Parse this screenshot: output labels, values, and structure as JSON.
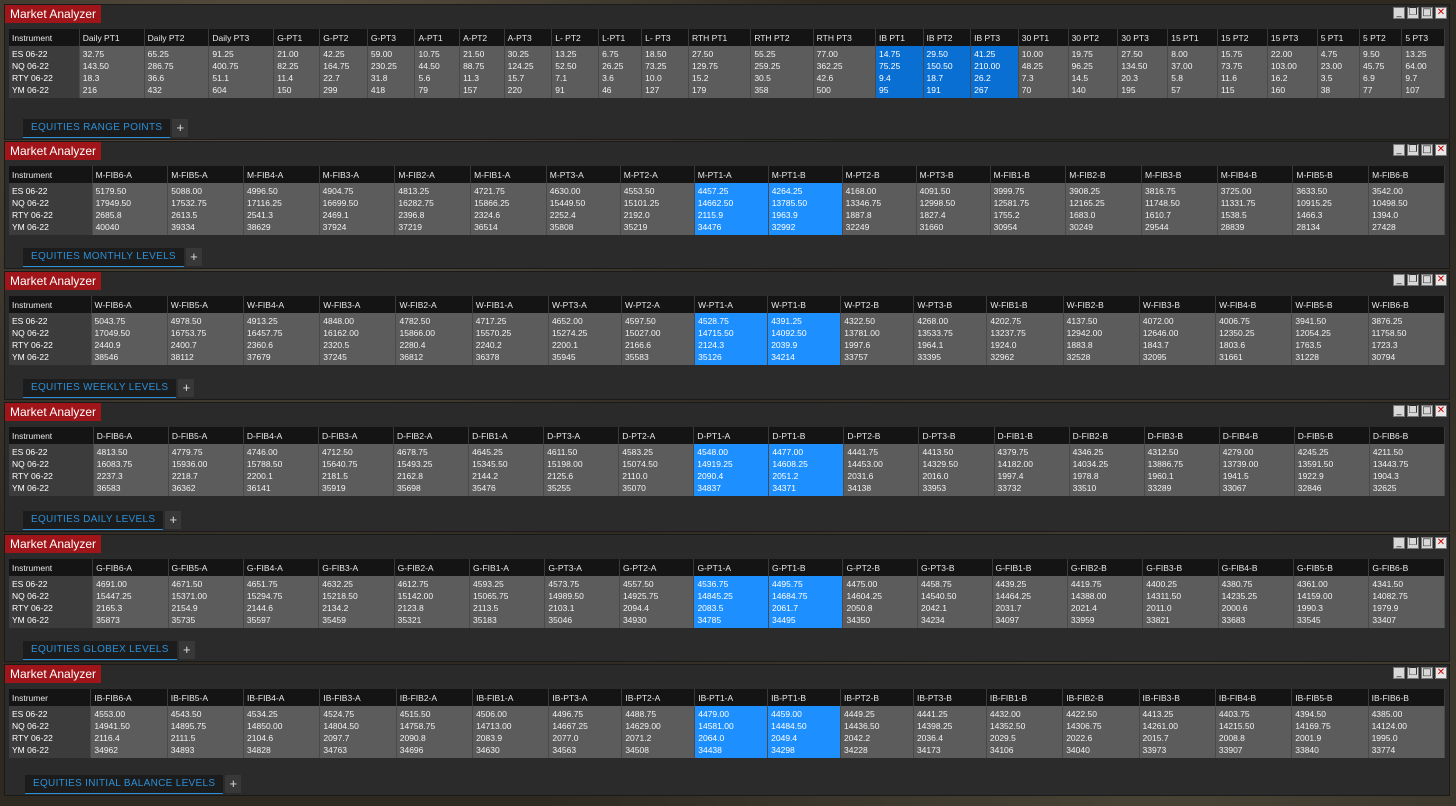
{
  "app_title": "Market Analyzer",
  "window_buttons": [
    "minimize-icon",
    "restore-icon",
    "maximize-icon",
    "close-icon"
  ],
  "colors": {
    "title_bg": "#a0151a",
    "highlight": "#1e8fff",
    "highlight_dark": "#0a6fd2",
    "tab_text": "#2d8fd6"
  },
  "windows": [
    {
      "tab": "EQUITIES RANGE POINTS",
      "headers": [
        "Instrument",
        "Daily PT1",
        "Daily PT2",
        "Daily PT3",
        "G-PT1",
        "G-PT2",
        "G-PT3",
        "A-PT1",
        "A-PT2",
        "A-PT3",
        "L- PT2",
        "L-PT1",
        "L- PT3",
        "RTH PT1",
        "RTH PT2",
        "RTH PT3",
        "IB PT1",
        "IB PT2",
        "IB PT3",
        "30 PT1",
        "30 PT2",
        "30 PT3",
        "15 PT1",
        "15 PT2",
        "15 PT3",
        "5 PT1",
        "5 PT2",
        "5 PT3"
      ],
      "highlight_cols": [
        16,
        17,
        18
      ],
      "dark_highlight": true,
      "rows": [
        [
          "ES 06-22",
          "32.75",
          "65.25",
          "91.25",
          "21.00",
          "42.25",
          "59.00",
          "10.75",
          "21.50",
          "30.25",
          "13.25",
          "6.75",
          "18.50",
          "27.50",
          "55.25",
          "77.00",
          "14.75",
          "29.50",
          "41.25",
          "10.00",
          "19.75",
          "27.50",
          "8.00",
          "15.75",
          "22.00",
          "4.75",
          "9.50",
          "13.25"
        ],
        [
          "NQ 06-22",
          "143.50",
          "286.75",
          "400.75",
          "82.25",
          "164.75",
          "230.25",
          "44.50",
          "88.75",
          "124.25",
          "52.50",
          "26.25",
          "73.25",
          "129.75",
          "259.25",
          "362.25",
          "75.25",
          "150.50",
          "210.00",
          "48.25",
          "96.25",
          "134.50",
          "37.00",
          "73.75",
          "103.00",
          "23.00",
          "45.75",
          "64.00"
        ],
        [
          "RTY 06-22",
          "18.3",
          "36.6",
          "51.1",
          "11.4",
          "22.7",
          "31.8",
          "5.6",
          "11.3",
          "15.7",
          "7.1",
          "3.6",
          "10.0",
          "15.2",
          "30.5",
          "42.6",
          "9.4",
          "18.7",
          "26.2",
          "7.3",
          "14.5",
          "20.3",
          "5.8",
          "11.6",
          "16.2",
          "3.5",
          "6.9",
          "9.7"
        ],
        [
          "YM 06-22",
          "216",
          "432",
          "604",
          "150",
          "299",
          "418",
          "79",
          "157",
          "220",
          "91",
          "46",
          "127",
          "179",
          "358",
          "500",
          "95",
          "191",
          "267",
          "70",
          "140",
          "195",
          "57",
          "115",
          "160",
          "38",
          "77",
          "107"
        ]
      ]
    },
    {
      "tab": "EQUITIES MONTHLY LEVELS",
      "headers": [
        "Instrument",
        "M-FIB6-A",
        "M-FIB5-A",
        "M-FIB4-A",
        "M-FIB3-A",
        "M-FIB2-A",
        "M-FIB1-A",
        "M-PT3-A",
        "M-PT2-A",
        "M-PT1-A",
        "M-PT1-B",
        "M-PT2-B",
        "M-PT3-B",
        "M-FIB1-B",
        "M-FIB2-B",
        "M-FIB3-B",
        "M-FIB4-B",
        "M-FIB5-B",
        "M-FIB6-B"
      ],
      "highlight_cols": [
        9,
        10
      ],
      "dark_highlight": false,
      "rows": [
        [
          "ES 06-22",
          "5179.50",
          "5088.00",
          "4996.50",
          "4904.75",
          "4813.25",
          "4721.75",
          "4630.00",
          "4553.50",
          "4457.25",
          "4264.25",
          "4168.00",
          "4091.50",
          "3999.75",
          "3908.25",
          "3816.75",
          "3725.00",
          "3633.50",
          "3542.00"
        ],
        [
          "NQ 06-22",
          "17949.50",
          "17532.75",
          "17116.25",
          "16699.50",
          "16282.75",
          "15866.25",
          "15449.50",
          "15101.25",
          "14662.50",
          "13785.50",
          "13346.75",
          "12998.50",
          "12581.75",
          "12165.25",
          "11748.50",
          "11331.75",
          "10915.25",
          "10498.50"
        ],
        [
          "RTY 06-22",
          "2685.8",
          "2613.5",
          "2541.3",
          "2469.1",
          "2396.8",
          "2324.6",
          "2252.4",
          "2192.0",
          "2115.9",
          "1963.9",
          "1887.8",
          "1827.4",
          "1755.2",
          "1683.0",
          "1610.7",
          "1538.5",
          "1466.3",
          "1394.0"
        ],
        [
          "YM 06-22",
          "40040",
          "39334",
          "38629",
          "37924",
          "37219",
          "36514",
          "35808",
          "35219",
          "34476",
          "32992",
          "32249",
          "31660",
          "30954",
          "30249",
          "29544",
          "28839",
          "28134",
          "27428"
        ]
      ]
    },
    {
      "tab": "EQUITIES WEEKLY LEVELS",
      "headers": [
        "Instrument",
        "W-FIB6-A",
        "W-FIB5-A",
        "W-FIB4-A",
        "W-FIB3-A",
        "W-FIB2-A",
        "W-FIB1-A",
        "W-PT3-A",
        "W-PT2-A",
        "W-PT1-A",
        "W-PT1-B",
        "W-PT2-B",
        "W-PT3-B",
        "W-FIB1-B",
        "W-FIB2-B",
        "W-FIB3-B",
        "W-FIB4-B",
        "W-FIB5-B",
        "W-FIB6-B"
      ],
      "highlight_cols": [
        9,
        10
      ],
      "dark_highlight": false,
      "rows": [
        [
          "ES 06-22",
          "5043.75",
          "4978.50",
          "4913.25",
          "4848.00",
          "4782.50",
          "4717.25",
          "4652.00",
          "4597.50",
          "4528.75",
          "4391.25",
          "4322.50",
          "4268.00",
          "4202.75",
          "4137.50",
          "4072.00",
          "4006.75",
          "3941.50",
          "3876.25"
        ],
        [
          "NQ 06-22",
          "17049.50",
          "16753.75",
          "16457.75",
          "16162.00",
          "15866.00",
          "15570.25",
          "15274.25",
          "15027.00",
          "14715.50",
          "14092.50",
          "13781.00",
          "13533.75",
          "13237.75",
          "12942.00",
          "12646.00",
          "12350.25",
          "12054.25",
          "11758.50"
        ],
        [
          "RTY 06-22",
          "2440.9",
          "2400.7",
          "2360.6",
          "2320.5",
          "2280.4",
          "2240.2",
          "2200.1",
          "2166.6",
          "2124.3",
          "2039.9",
          "1997.6",
          "1964.1",
          "1924.0",
          "1883.8",
          "1843.7",
          "1803.6",
          "1763.5",
          "1723.3"
        ],
        [
          "YM 06-22",
          "38546",
          "38112",
          "37679",
          "37245",
          "36812",
          "36378",
          "35945",
          "35583",
          "35126",
          "34214",
          "33757",
          "33395",
          "32962",
          "32528",
          "32095",
          "31661",
          "31228",
          "30794"
        ]
      ]
    },
    {
      "tab": "EQUITIES DAILY LEVELS",
      "headers": [
        "Instrument",
        "D-FIB6-A",
        "D-FIB5-A",
        "D-FIB4-A",
        "D-FIB3-A",
        "D-FIB2-A",
        "D-FIB1-A",
        "D-PT3-A",
        "D-PT2-A",
        "D-PT1-A",
        "D-PT1-B",
        "D-PT2-B",
        "D-PT3-B",
        "D-FIB1-B",
        "D-FIB2-B",
        "D-FIB3-B",
        "D-FIB4-B",
        "D-FIB5-B",
        "D-FIB6-B"
      ],
      "highlight_cols": [
        9,
        10
      ],
      "dark_highlight": false,
      "rows": [
        [
          "ES 06-22",
          "4813.50",
          "4779.75",
          "4746.00",
          "4712.50",
          "4678.75",
          "4645.25",
          "4611.50",
          "4583.25",
          "4548.00",
          "4477.00",
          "4441.75",
          "4413.50",
          "4379.75",
          "4346.25",
          "4312.50",
          "4279.00",
          "4245.25",
          "4211.50"
        ],
        [
          "NQ 06-22",
          "16083.75",
          "15936.00",
          "15788.50",
          "15640.75",
          "15493.25",
          "15345.50",
          "15198.00",
          "15074.50",
          "14919.25",
          "14608.25",
          "14453.00",
          "14329.50",
          "14182.00",
          "14034.25",
          "13886.75",
          "13739.00",
          "13591.50",
          "13443.75"
        ],
        [
          "RTY 06-22",
          "2237.3",
          "2218.7",
          "2200.1",
          "2181.5",
          "2162.8",
          "2144.2",
          "2125.6",
          "2110.0",
          "2090.4",
          "2051.2",
          "2031.6",
          "2016.0",
          "1997.4",
          "1978.8",
          "1960.1",
          "1941.5",
          "1922.9",
          "1904.3"
        ],
        [
          "YM 06-22",
          "36583",
          "36362",
          "36141",
          "35919",
          "35698",
          "35476",
          "35255",
          "35070",
          "34837",
          "34371",
          "34138",
          "33953",
          "33732",
          "33510",
          "33289",
          "33067",
          "32846",
          "32625"
        ]
      ]
    },
    {
      "tab": "EQUITIES GLOBEX LEVELS",
      "headers": [
        "Instrument",
        "G-FIB6-A",
        "G-FIB5-A",
        "G-FIB4-A",
        "G-FIB3-A",
        "G-FIB2-A",
        "G-FIB1-A",
        "G-PT3-A",
        "G-PT2-A",
        "G-PT1-A",
        "G-PT1-B",
        "G-PT2-B",
        "G-PT3-B",
        "G-FIB1-B",
        "G-FIB2-B",
        "G-FIB3-B",
        "G-FIB4-B",
        "G-FIB5-B",
        "G-FIB6-B"
      ],
      "highlight_cols": [
        9,
        10
      ],
      "dark_highlight": false,
      "rows": [
        [
          "ES 06-22",
          "4691.00",
          "4671.50",
          "4651.75",
          "4632.25",
          "4612.75",
          "4593.25",
          "4573.75",
          "4557.50",
          "4536.75",
          "4495.75",
          "4475.00",
          "4458.75",
          "4439.25",
          "4419.75",
          "4400.25",
          "4380.75",
          "4361.00",
          "4341.50"
        ],
        [
          "NQ 06-22",
          "15447.25",
          "15371.00",
          "15294.75",
          "15218.50",
          "15142.00",
          "15065.75",
          "14989.50",
          "14925.75",
          "14845.25",
          "14684.75",
          "14604.25",
          "14540.50",
          "14464.25",
          "14388.00",
          "14311.50",
          "14235.25",
          "14159.00",
          "14082.75"
        ],
        [
          "RTY 06-22",
          "2165.3",
          "2154.9",
          "2144.6",
          "2134.2",
          "2123.8",
          "2113.5",
          "2103.1",
          "2094.4",
          "2083.5",
          "2061.7",
          "2050.8",
          "2042.1",
          "2031.7",
          "2021.4",
          "2011.0",
          "2000.6",
          "1990.3",
          "1979.9"
        ],
        [
          "YM 06-22",
          "35873",
          "35735",
          "35597",
          "35459",
          "35321",
          "35183",
          "35046",
          "34930",
          "34785",
          "34495",
          "34350",
          "34234",
          "34097",
          "33959",
          "33821",
          "33683",
          "33545",
          "33407"
        ]
      ]
    },
    {
      "tab": "EQUITIES INITIAL BALANCE LEVELS",
      "headers": [
        "Instrumer",
        "IB-FIB6-A",
        "IB-FIB5-A",
        "IB-FIB4-A",
        "IB-FIB3-A",
        "IB-FIB2-A",
        "IB-FIB1-A",
        "IB-PT3-A",
        "IB-PT2-A",
        "IB-PT1-A",
        "IB-PT1-B",
        "IB-PT2-B",
        "IB-PT3-B",
        "IB-FIB1-B",
        "IB-FIB2-B",
        "IB-FIB3-B",
        "IB-FIB4-B",
        "IB-FIB5-B",
        "IB-FIB6-B"
      ],
      "highlight_cols": [
        9,
        10
      ],
      "dark_highlight": false,
      "rows": [
        [
          "ES 06-22",
          "4553.00",
          "4543.50",
          "4534.25",
          "4524.75",
          "4515.50",
          "4506.00",
          "4496.75",
          "4488.75",
          "4479.00",
          "4459.00",
          "4449.25",
          "4441.25",
          "4432.00",
          "4422.50",
          "4413.25",
          "4403.75",
          "4394.50",
          "4385.00"
        ],
        [
          "NQ 06-22",
          "14941.50",
          "14895.75",
          "14850.00",
          "14804.50",
          "14758.75",
          "14713.00",
          "14667.25",
          "14629.00",
          "14581.00",
          "14484.50",
          "14436.50",
          "14398.25",
          "14352.50",
          "14306.75",
          "14261.00",
          "14215.50",
          "14169.75",
          "14124.00"
        ],
        [
          "RTY 06-22",
          "2116.4",
          "2111.5",
          "2104.6",
          "2097.7",
          "2090.8",
          "2083.9",
          "2077.0",
          "2071.2",
          "2064.0",
          "2049.4",
          "2042.2",
          "2036.4",
          "2029.5",
          "2022.6",
          "2015.7",
          "2008.8",
          "2001.9",
          "1995.0"
        ],
        [
          "YM 06-22",
          "34962",
          "34893",
          "34828",
          "34763",
          "34696",
          "34630",
          "34563",
          "34508",
          "34438",
          "34298",
          "34228",
          "34173",
          "34106",
          "34040",
          "33973",
          "33907",
          "33840",
          "33774"
        ]
      ]
    }
  ]
}
